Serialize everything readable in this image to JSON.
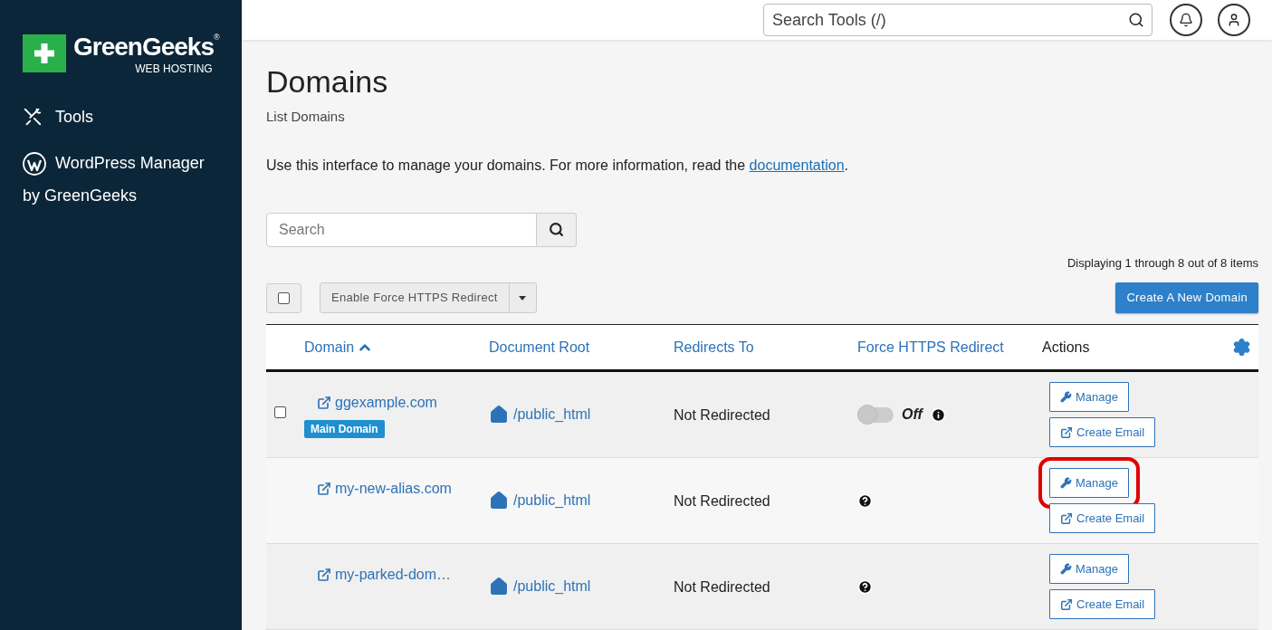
{
  "sidebar": {
    "logo": {
      "name": "GreenGeeks",
      "mark": "®",
      "tagline": "WEB HOSTING"
    },
    "items": [
      {
        "kind": "tools",
        "label": "Tools"
      },
      {
        "kind": "wordpress",
        "label": "WordPress Manager by GreenGeeks"
      }
    ]
  },
  "header": {
    "search": {
      "placeholder": "Search Tools (/)"
    }
  },
  "page": {
    "title": "Domains",
    "subtitle": "List Domains",
    "intro": "Use this interface to manage your domains. For more information, read the ",
    "intro_link": "documentation",
    "intro_end": "."
  },
  "search": {
    "placeholder": "Search"
  },
  "count": "Displaying 1 through 8 out of 8 items",
  "bulk": {
    "checked": false,
    "action": "Enable Force HTTPS Redirect"
  },
  "create_button": "Create A New Domain",
  "table": {
    "columns": [
      {
        "label": "Domain",
        "kind": "link",
        "sorted": true
      },
      {
        "label": "Document Root",
        "kind": "link",
        "sorted": false
      },
      {
        "label": "Redirects To",
        "kind": "link",
        "sorted": false
      },
      {
        "label": "Force HTTPS Redirect",
        "kind": "link",
        "sorted": false
      },
      {
        "label": "Actions",
        "kind": "plain",
        "sorted": false
      }
    ],
    "rows": [
      {
        "checked": false,
        "domain": "ggexample.com",
        "badge": "Main Domain",
        "root": "/public_html",
        "redirect": "Not Redirected",
        "https": {
          "kind": "toggle",
          "on": false,
          "label": "Off"
        },
        "actions": [
          {
            "kind": "manage",
            "label": "Manage",
            "highlighted": false
          },
          {
            "kind": "email",
            "label": "Create Email",
            "highlighted": false
          }
        ]
      },
      {
        "domain": "my-new-alias.com",
        "root": "/public_html",
        "redirect": "Not Redirected",
        "https": {
          "kind": "help"
        },
        "actions": [
          {
            "kind": "manage",
            "label": "Manage",
            "highlighted": true
          },
          {
            "kind": "email",
            "label": "Create Email",
            "highlighted": false
          }
        ]
      },
      {
        "domain": "my-parked-dom…",
        "root": "/public_html",
        "redirect": "Not Redirected",
        "https": {
          "kind": "help"
        },
        "actions": [
          {
            "kind": "manage",
            "label": "Manage",
            "highlighted": false
          },
          {
            "kind": "email",
            "label": "Create Email",
            "highlighted": false
          }
        ]
      }
    ]
  }
}
